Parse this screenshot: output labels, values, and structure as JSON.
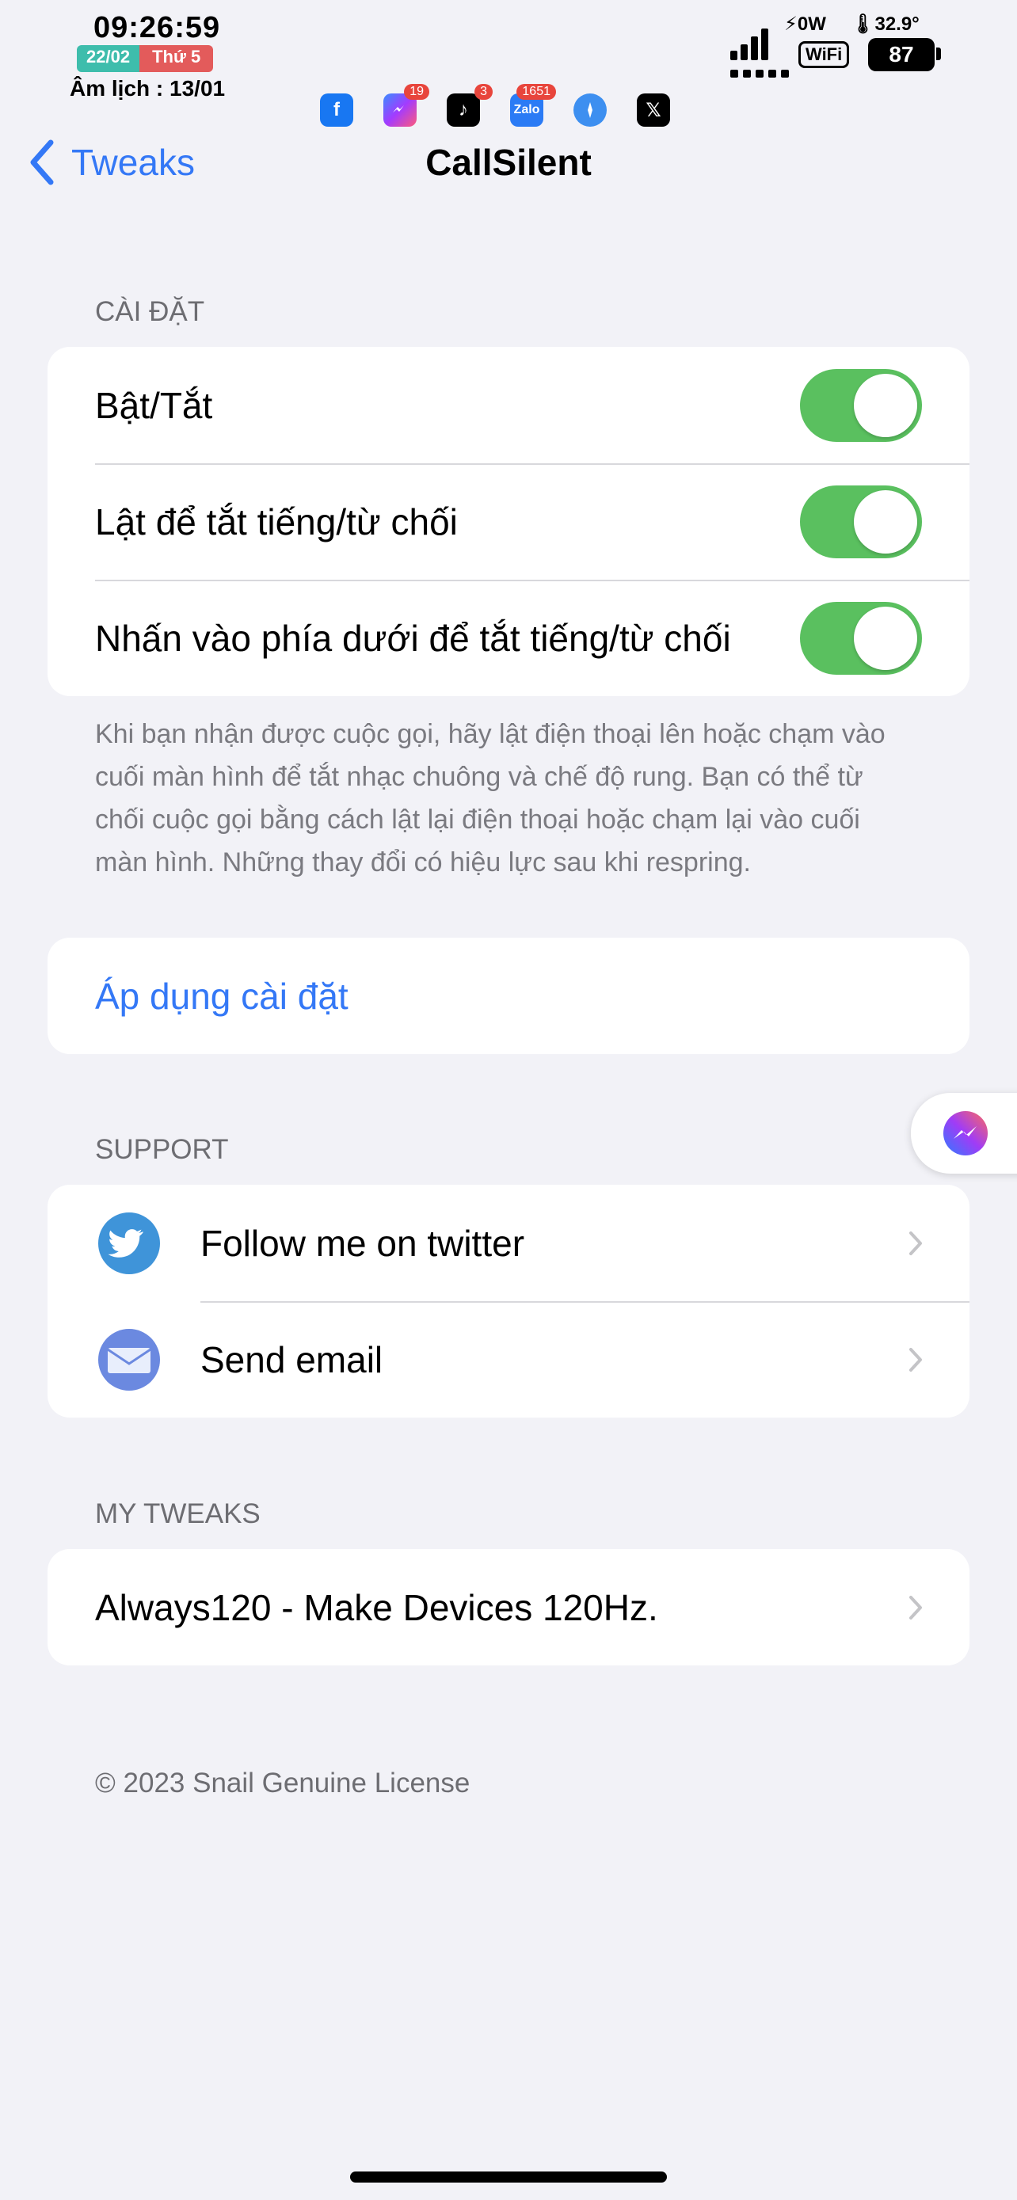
{
  "status": {
    "time": "09:26:59",
    "date": "22/02",
    "weekday": "Thứ 5",
    "lunar": "Âm lịch : 13/01",
    "power": "⚡0W",
    "temperature": "🌡32.9°",
    "wifi_label": "WiFi",
    "battery": "87",
    "apps": [
      {
        "name": "facebook",
        "badge": ""
      },
      {
        "name": "messenger",
        "badge": "19"
      },
      {
        "name": "tiktok",
        "badge": "3"
      },
      {
        "name": "zalo",
        "badge": "1651"
      },
      {
        "name": "safari",
        "badge": ""
      },
      {
        "name": "x",
        "badge": ""
      }
    ]
  },
  "nav": {
    "back_label": "Tweaks",
    "title": "CallSilent"
  },
  "settings": {
    "header": "CÀI ĐẶT",
    "rows": [
      {
        "label": "Bật/Tắt",
        "on": true
      },
      {
        "label": "Lật để tắt tiếng/từ chối",
        "on": true
      },
      {
        "label": "Nhấn vào phía dưới để tắt tiếng/từ chối",
        "on": true
      }
    ],
    "footer": "Khi bạn nhận được cuộc gọi, hãy lật điện thoại lên hoặc chạm vào cuối màn hình để tắt nhạc chuông và chế độ rung. Bạn có thể từ chối cuộc gọi bằng cách lật lại điện thoại hoặc chạm lại vào cuối màn hình. Những thay đổi có hiệu lực sau khi respring."
  },
  "apply": {
    "label": "Áp dụng cài đặt"
  },
  "support": {
    "header": "SUPPORT",
    "rows": [
      {
        "label": "Follow me on twitter",
        "icon": "twitter-icon"
      },
      {
        "label": "Send email",
        "icon": "mail-icon"
      }
    ]
  },
  "my_tweaks": {
    "header": "MY TWEAKS",
    "rows": [
      {
        "label": "Always120 - Make Devices 120Hz."
      }
    ]
  },
  "copyright": "© 2023 Snail Genuine License",
  "colors": {
    "accent": "#3478f6",
    "toggle_on": "#5ac05f",
    "background": "#f2f2f7"
  }
}
